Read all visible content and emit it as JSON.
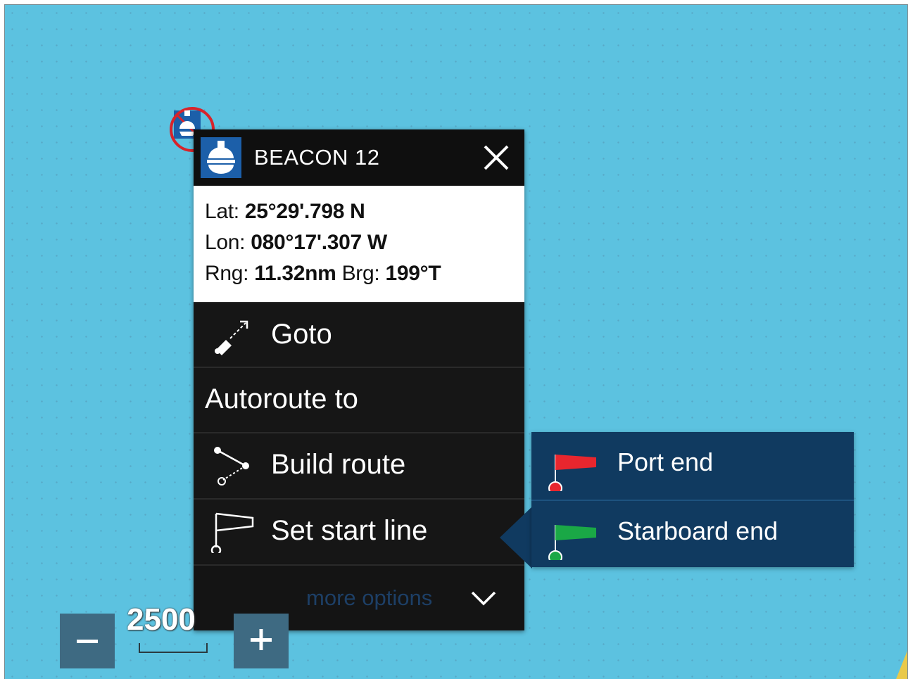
{
  "popup": {
    "title": "BEACON 12",
    "lat_label": "Lat:",
    "lat_value": "25°29'.798 N",
    "lon_label": "Lon:",
    "lon_value": "080°17'.307 W",
    "rng_label": "Rng:",
    "rng_value": "11.32nm",
    "brg_label": "Brg:",
    "brg_value": "199°T",
    "menu": {
      "goto": "Goto",
      "autoroute": "Autoroute to",
      "build_route": "Build route",
      "set_start_line": "Set start line",
      "more_options": "more options"
    }
  },
  "submenu": {
    "port_end": "Port end",
    "starboard_end": "Starboard end"
  },
  "zoom": {
    "minus": "−",
    "plus": "+",
    "scale": "2500"
  },
  "colors": {
    "sea": "#5cc2e0",
    "popup_bg": "#151515",
    "header_icon_bg": "#1c5fa9",
    "submenu_bg": "#103a60",
    "port_flag": "#e8262e",
    "starboard_flag": "#1aa846"
  },
  "icons": {
    "header": "beacon-icon",
    "goto": "goto-arrow-icon",
    "build_route": "route-icon",
    "start_line": "start-flag-icon",
    "more": "chevron-down-icon",
    "close": "close-icon"
  }
}
